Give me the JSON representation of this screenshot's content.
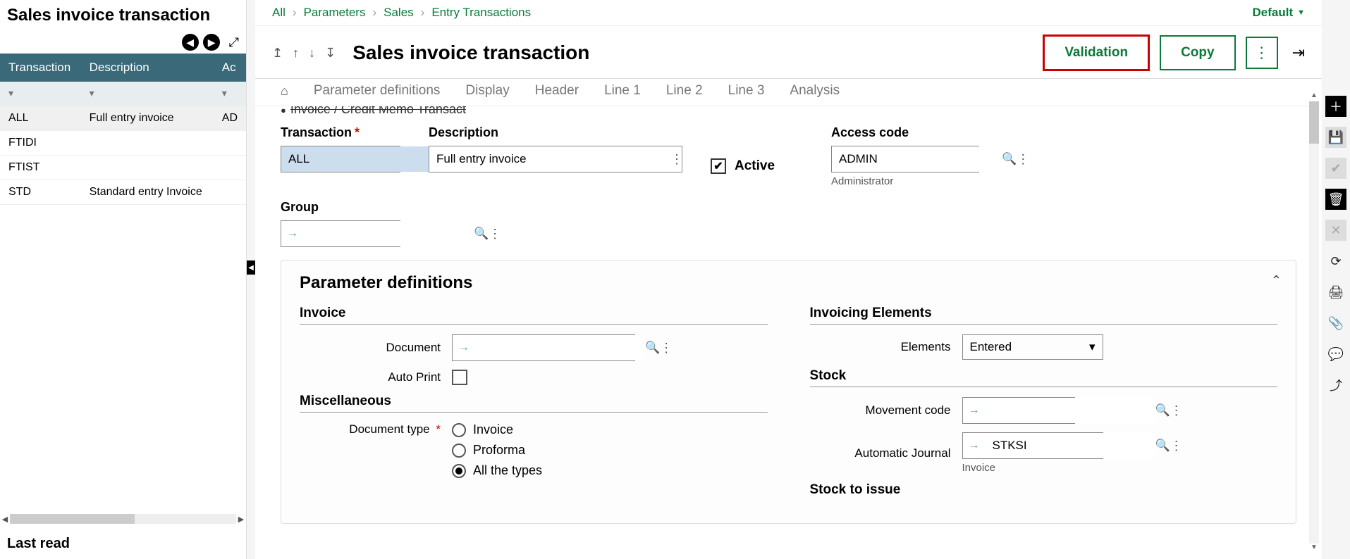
{
  "leftPanel": {
    "title": "Sales invoice transaction",
    "columns": [
      "Transaction",
      "Description",
      "Ac"
    ],
    "rows": [
      {
        "trx": "ALL",
        "desc": "Full entry invoice",
        "ac": "AD"
      },
      {
        "trx": "FTIDI",
        "desc": "",
        "ac": ""
      },
      {
        "trx": "FTIST",
        "desc": "",
        "ac": ""
      },
      {
        "trx": "STD",
        "desc": "Standard entry Invoice",
        "ac": ""
      }
    ],
    "lastRead": "Last read"
  },
  "breadcrumb": {
    "items": [
      "All",
      "Parameters",
      "Sales",
      "Entry Transactions"
    ],
    "right": "Default"
  },
  "mainTitle": "Sales invoice transaction",
  "actions": {
    "validation": "Validation",
    "copy": "Copy"
  },
  "tabs": [
    "Parameter definitions",
    "Display",
    "Header",
    "Line 1",
    "Line 2",
    "Line 3",
    "Analysis"
  ],
  "partialHeader": "Invoice / Credit Memo Transact",
  "fields": {
    "transactionLabel": "Transaction",
    "transactionValue": "ALL",
    "descriptionLabel": "Description",
    "descriptionValue": "Full entry invoice",
    "activeLabel": "Active",
    "accessLabel": "Access code",
    "accessValue": "ADMIN",
    "accessHint": "Administrator",
    "groupLabel": "Group"
  },
  "paramSection": {
    "title": "Parameter definitions",
    "invoiceHead": "Invoice",
    "documentLabel": "Document",
    "autoPrintLabel": "Auto Print",
    "miscHead": "Miscellaneous",
    "docTypeLabel": "Document type",
    "docTypeOptions": [
      "Invoice",
      "Proforma",
      "All the types"
    ],
    "invElemHead": "Invoicing Elements",
    "elementsLabel": "Elements",
    "elementsValue": "Entered",
    "stockHead": "Stock",
    "movementLabel": "Movement code",
    "autoJournalLabel": "Automatic Journal",
    "autoJournalValue": "STKSI",
    "autoJournalHint": "Invoice",
    "stockIssueHead": "Stock to issue"
  }
}
